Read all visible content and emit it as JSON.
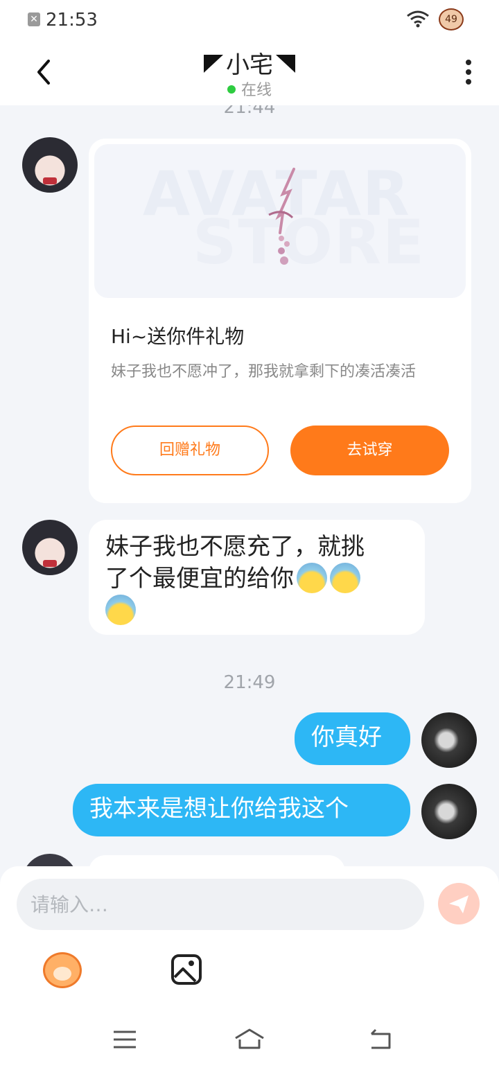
{
  "status_bar": {
    "time": "21:53",
    "close_glyph": "✕",
    "badge": "49"
  },
  "header": {
    "title": "小宅",
    "status": "在线",
    "status_color": "#2ecc40"
  },
  "messages": {
    "timestamp_1": "21:44",
    "gift_card": {
      "watermark_line1": "AVATAR",
      "watermark_line2": "STORE",
      "title": "Hi~送你件礼物",
      "description": "妹子我也不愿冲了，那我就拿剩下的凑活凑活",
      "return_gift_label": "回赠礼物",
      "try_on_label": "去试穿"
    },
    "text_1_line1": "妹子我也不愿充了，就挑",
    "text_1_line2": "了个最便宜的给你",
    "timestamp_2": "21:49",
    "out_1": "你真好",
    "out_2": "我本来是想让你给我这个"
  },
  "input": {
    "placeholder": "请输入…"
  },
  "colors": {
    "accent_orange": "#ff7a1a",
    "bubble_blue": "#2db7f5"
  },
  "icons": {
    "back": "chevron-left-icon",
    "more": "more-vertical-icon",
    "send": "send-icon",
    "mascot": "mascot-icon",
    "image": "image-icon",
    "menu": "menu-icon",
    "home": "home-icon",
    "back_nav": "back-icon"
  }
}
